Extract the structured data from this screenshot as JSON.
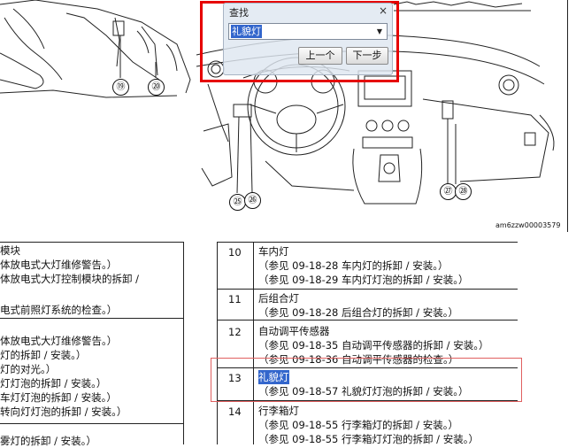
{
  "illustration": {
    "callouts": [
      "⑲",
      "⑳",
      "㉕",
      "㉖",
      "㉗",
      "㉘"
    ],
    "ref_code": "am6zzw00003579"
  },
  "find_dialog": {
    "title": "查找",
    "close_glyph": "×",
    "search_value": "礼貌灯",
    "dropdown_glyph": "▼",
    "prev_label": "上一个",
    "next_label": "下一步"
  },
  "left_column": {
    "lines": [
      "模块",
      "体放电式大灯维修警告。）",
      "体放电式大灯控制模块的拆卸 /",
      "",
      "电式前照灯系统的检查。）",
      "",
      "体放电式大灯维修警告。）",
      "灯的拆卸 / 安装。）",
      "灯的对光。）",
      "灯灯泡的拆卸 / 安装。）",
      "车灯灯泡的拆卸 / 安装。）",
      "转向灯灯泡的拆卸 / 安装。）",
      "",
      "雾灯的拆卸 / 安装。）"
    ]
  },
  "right_table": {
    "rows": [
      {
        "number": "10",
        "title": "车内灯",
        "refs": [
          "（参见 09-18-28 车内灯的拆卸 / 安装。）",
          "（参见 09-18-29 车内灯灯泡的拆卸 / 安装。）"
        ]
      },
      {
        "number": "11",
        "title": "后组合灯",
        "refs": [
          "（参见 09-18-28 后组合灯的拆卸 / 安装。）"
        ]
      },
      {
        "number": "12",
        "title": "自动调平传感器",
        "refs": [
          "（参见 09-18-35 自动调平传感器的拆卸 / 安装。）",
          "（参见 09-18-36 自动调平传感器的检查。）"
        ]
      },
      {
        "number": "13",
        "title": "礼貌灯",
        "refs": [
          "（参见 09-18-57 礼貌灯灯泡的拆卸 / 安装。）"
        ]
      },
      {
        "number": "14",
        "title": "行李箱灯",
        "refs": [
          "（参见 09-18-55 行李箱灯的拆卸 / 安装。）",
          "（参见 09-18-55 行李箱灯灯泡的拆卸 / 安装。）"
        ]
      }
    ]
  }
}
